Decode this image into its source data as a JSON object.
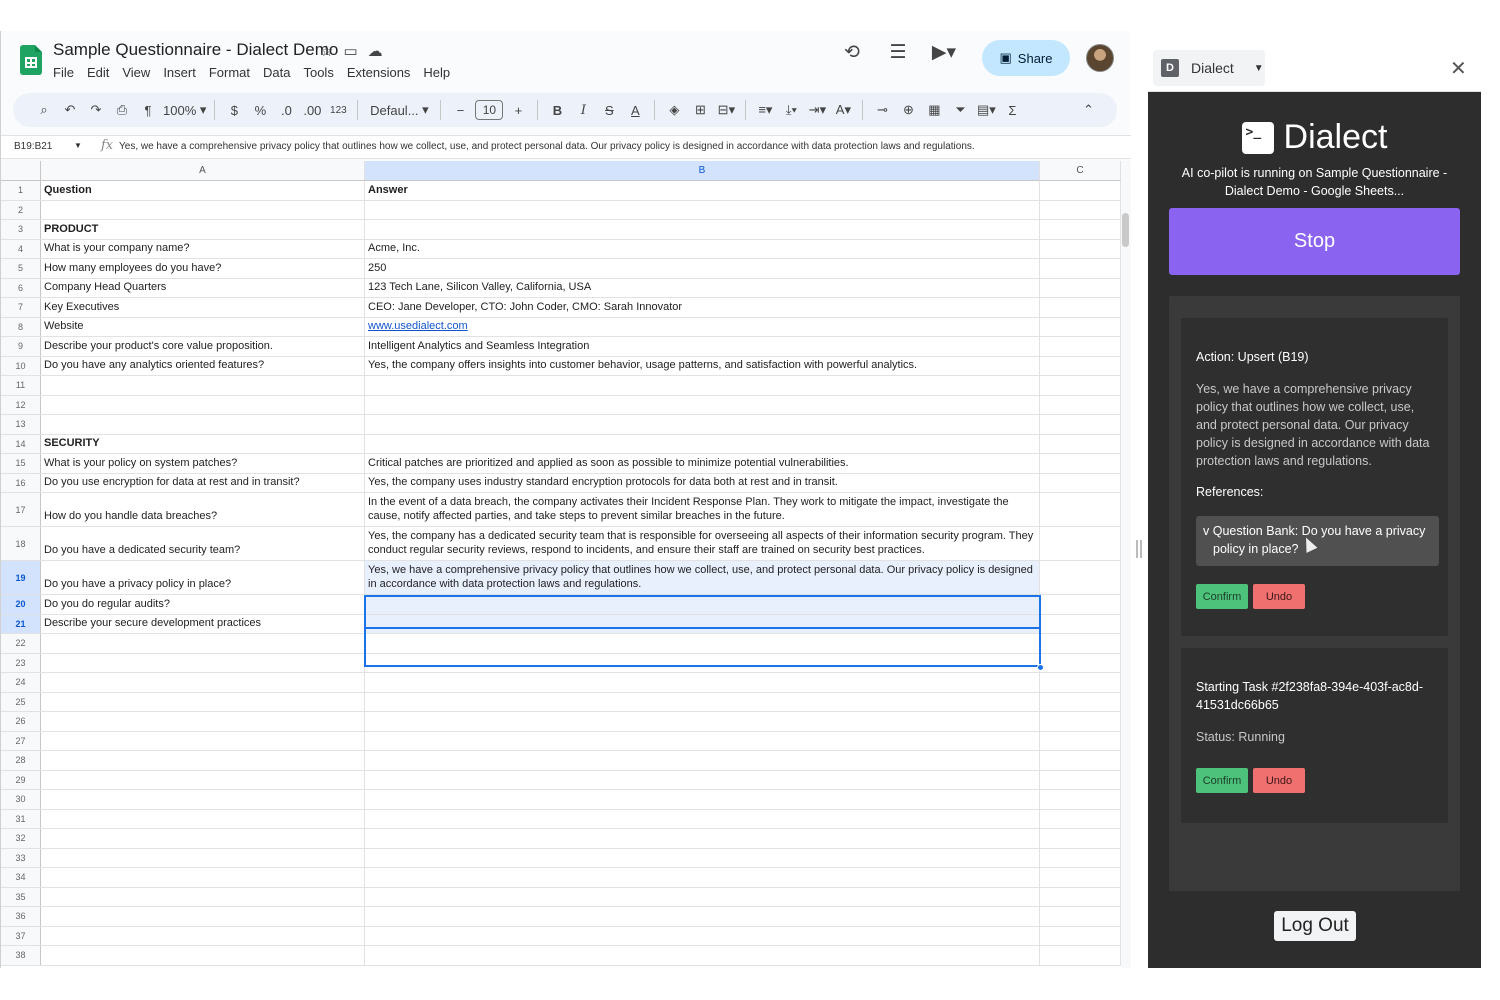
{
  "sheets": {
    "doc_title": "Sample Questionnaire - Dialect Demo",
    "menu": [
      "File",
      "Edit",
      "View",
      "Insert",
      "Format",
      "Data",
      "Tools",
      "Extensions",
      "Help"
    ],
    "share_label": "Share",
    "toolbar": {
      "zoom": "100%",
      "currency": "$",
      "percent": "%",
      "decrease_decimal": ".0",
      "increase_decimal": ".00",
      "number_format": "123",
      "font": "Defaul...",
      "font_size": "10"
    },
    "name_box": "B19:B21",
    "formula_text": "Yes, we have a comprehensive privacy policy that outlines how we collect, use, and protect personal data. Our privacy policy is designed in accordance with data protection laws and regulations.",
    "columns": [
      "A",
      "B",
      "C"
    ],
    "rows": [
      {
        "n": "1",
        "a": "Question",
        "b": "Answer"
      },
      {
        "n": "2",
        "a": "",
        "b": ""
      },
      {
        "n": "3",
        "a": "PRODUCT",
        "b": ""
      },
      {
        "n": "4",
        "a": "What is your company name?",
        "b": "Acme, Inc."
      },
      {
        "n": "5",
        "a": "How many employees do you have?",
        "b": "250"
      },
      {
        "n": "6",
        "a": "Company Head Quarters",
        "b": "123 Tech Lane, Silicon Valley, California, USA"
      },
      {
        "n": "7",
        "a": "Key Executives",
        "b": "CEO: Jane Developer, CTO: John Coder, CMO: Sarah Innovator"
      },
      {
        "n": "8",
        "a": "Website",
        "b": "www.usedialect.com"
      },
      {
        "n": "9",
        "a": "Describe your product's core value proposition.",
        "b": "Intelligent Analytics and Seamless Integration"
      },
      {
        "n": "10",
        "a": "Do you have any analytics oriented features?",
        "b": "Yes, the company offers insights into customer behavior, usage patterns, and satisfaction with powerful analytics."
      },
      {
        "n": "11",
        "a": "",
        "b": ""
      },
      {
        "n": "12",
        "a": "",
        "b": ""
      },
      {
        "n": "13",
        "a": "",
        "b": ""
      },
      {
        "n": "14",
        "a": "SECURITY",
        "b": ""
      },
      {
        "n": "15",
        "a": "What is your policy on system patches?",
        "b": "Critical patches are prioritized and applied as soon as possible to minimize potential vulnerabilities."
      },
      {
        "n": "16",
        "a": "Do you use encryption for data at rest and in transit?",
        "b": "Yes, the company uses industry standard encryption protocols for data both at rest and in transit."
      },
      {
        "n": "17",
        "a": "How do you handle data breaches?",
        "b": "In the event of a data breach, the company activates their Incident Response Plan. They work to mitigate the impact, investigate the cause, notify affected parties, and take steps to prevent similar breaches in the future."
      },
      {
        "n": "18",
        "a": "Do you have a dedicated security team?",
        "b": "Yes, the company has a dedicated security team that is responsible for overseeing all aspects of their information security program. They conduct regular security reviews, respond to incidents, and ensure their staff are trained on security best practices."
      },
      {
        "n": "19",
        "a": "Do you have a privacy policy in place?",
        "b": "Yes, we have a comprehensive privacy policy that outlines how we collect, use, and protect personal data. Our privacy policy is designed in accordance with data protection laws and regulations."
      },
      {
        "n": "20",
        "a": "Do you do regular audits?",
        "b": ""
      },
      {
        "n": "21",
        "a": "Describe your secure development practices",
        "b": ""
      },
      {
        "n": "22",
        "a": "",
        "b": ""
      },
      {
        "n": "23",
        "a": "",
        "b": ""
      },
      {
        "n": "24",
        "a": "",
        "b": ""
      },
      {
        "n": "25",
        "a": "",
        "b": ""
      },
      {
        "n": "26",
        "a": "",
        "b": ""
      },
      {
        "n": "27",
        "a": "",
        "b": ""
      },
      {
        "n": "28",
        "a": "",
        "b": ""
      },
      {
        "n": "29",
        "a": "",
        "b": ""
      },
      {
        "n": "30",
        "a": "",
        "b": ""
      },
      {
        "n": "31",
        "a": "",
        "b": ""
      },
      {
        "n": "32",
        "a": "",
        "b": ""
      },
      {
        "n": "33",
        "a": "",
        "b": ""
      },
      {
        "n": "34",
        "a": "",
        "b": ""
      },
      {
        "n": "35",
        "a": "",
        "b": ""
      },
      {
        "n": "36",
        "a": "",
        "b": ""
      },
      {
        "n": "37",
        "a": "",
        "b": ""
      },
      {
        "n": "38",
        "a": "",
        "b": ""
      }
    ]
  },
  "panel": {
    "tab_label": "Dialect",
    "tab_letter": "D",
    "brand": "Dialect",
    "brand_glyph": ">_",
    "tagline": "AI co-pilot is running on Sample Questionnaire - Dialect Demo - Google Sheets...",
    "stop_label": "Stop",
    "card1": {
      "action": "Action: Upsert (B19)",
      "answer": "Yes, we have a comprehensive privacy policy that outlines how we collect, use, and protect personal data. Our privacy policy is designed in accordance with data protection laws and regulations.",
      "references_label": "References:",
      "ref_line1": "v Question Bank: Do you have a privacy",
      "ref_line2": "policy in place?",
      "confirm": "Confirm",
      "undo": "Undo"
    },
    "card2": {
      "task": "Starting Task #2f238fa8-394e-403f-ac8d-41531dc66b65",
      "status": "Status: Running",
      "confirm": "Confirm",
      "undo": "Undo"
    },
    "logout_label": "Log Out"
  },
  "colors": {
    "accent_purple": "#8a63f0",
    "confirm_green": "#4cc27a",
    "undo_red": "#f07070",
    "selection_blue": "#1a73e8",
    "panel_dark": "#2d2d2d"
  }
}
